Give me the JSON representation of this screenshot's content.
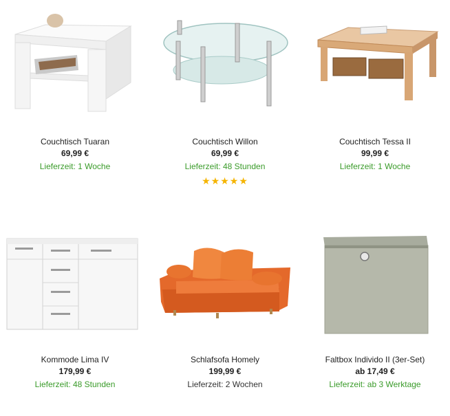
{
  "products": [
    {
      "name": "Couchtisch Tuaran",
      "price": "69,99 €",
      "availability": "Lieferzeit: 1 Woche",
      "availability_color": "#3a9b2a",
      "image_icon": "white-square-coffee-table"
    },
    {
      "name": "Couchtisch Willon",
      "price": "69,99 €",
      "availability": "Lieferzeit: 48 Stunden",
      "availability_color": "#3a9b2a",
      "rating_stars": 5,
      "rating_display": "★★★★★",
      "image_icon": "glass-oval-coffee-table"
    },
    {
      "name": "Couchtisch Tessa II",
      "price": "99,99 €",
      "availability": "Lieferzeit: 1 Woche",
      "availability_color": "#3a9b2a",
      "image_icon": "wood-coffee-table-with-baskets"
    },
    {
      "name": "Kommode Lima IV",
      "price": "179,99 €",
      "availability": "Lieferzeit: 48 Stunden",
      "availability_color": "#3a9b2a",
      "image_icon": "white-sideboard"
    },
    {
      "name": "Schlafsofa Homely",
      "price": "199,99 €",
      "availability": "Lieferzeit: 2 Wochen",
      "availability_color": "#333333",
      "rating_display": "★★★★★",
      "image_icon": "orange-sofa-bed"
    },
    {
      "name": "Faltbox Individo II (3er-Set)",
      "price": "ab 17,49 €",
      "availability": "Lieferzeit: ab 3 Werktage",
      "availability_color": "#3a9b2a",
      "image_icon": "grey-folding-box"
    }
  ]
}
